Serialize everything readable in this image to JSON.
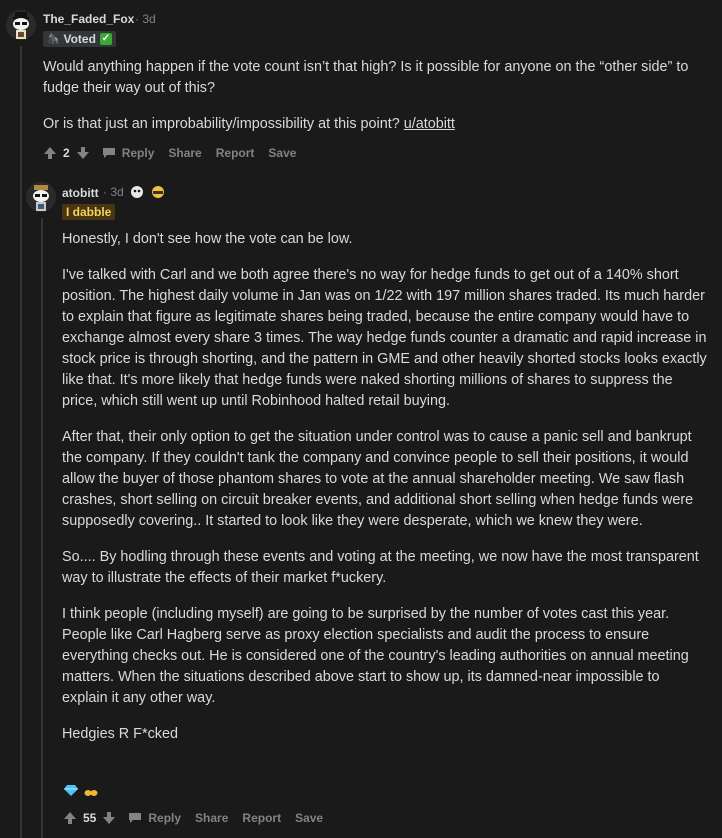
{
  "comment1": {
    "username": "The_Faded_Fox",
    "time": "· 3d",
    "flair_label": "Voted",
    "flair_check": "✓",
    "paragraphs": [
      "Would anything happen if the vote count isn’t that high? Is it possible for anyone on the “other side” to fudge their way out of this?",
      "Or is that just an improbability/impossibility at this point?"
    ],
    "mention": "u/atobitt",
    "votes": "2",
    "actions": {
      "reply": "Reply",
      "share": "Share",
      "report": "Report",
      "save": "Save"
    }
  },
  "comment2": {
    "username": "atobitt",
    "time": "· 3d",
    "flair_label": "I dabble",
    "paragraphs": [
      "Honestly, I don't see how the vote can be low.",
      "I've talked with Carl and we both agree there's no way for hedge funds to get out of a 140% short position. The highest daily volume in Jan was on 1/22 with 197 million shares traded. Its much harder to explain that figure as legitimate shares being traded, because the entire company would have to exchange almost every share 3 times. The way hedge funds counter a dramatic and rapid increase in stock price is through shorting, and the pattern in GME and other heavily shorted stocks looks exactly like that. It's more likely that hedge funds were naked shorting millions of shares to suppress the price, which still went up until Robinhood halted retail buying.",
      "After that, their only option to get the situation under control was to cause a panic sell and bankrupt the company. If they couldn't tank the company and convince people to sell their positions, it would allow the buyer of those phantom shares to vote at the annual shareholder meeting. We saw flash crashes, short selling on circuit breaker events, and additional short selling when hedge funds were supposedly covering.. It started to look like they were desperate, which we knew they were.",
      "So.... By hodling through these events and voting at the meeting, we now have the most transparent way to illustrate the effects of their market f*uckery.",
      "I think people (including myself) are going to be surprised by the number of votes cast this year. People like Carl Hagberg serve as proxy election specialists and audit the process to ensure everything checks out. He is considered one of the country's leading authorities on annual meeting matters. When the situations described above start to show up, its damned-near impossible to explain it any other way.",
      "Hedgies R F*cked"
    ],
    "votes": "55",
    "actions": {
      "reply": "Reply",
      "share": "Share",
      "report": "Report",
      "save": "Save"
    }
  },
  "colors": {
    "background": "#1a1a1b",
    "text": "#d7dadc",
    "muted": "#818384",
    "flair_voted_bg": "#343536",
    "flair_dabble_bg": "#4a3512",
    "check_green": "#3aa835"
  }
}
